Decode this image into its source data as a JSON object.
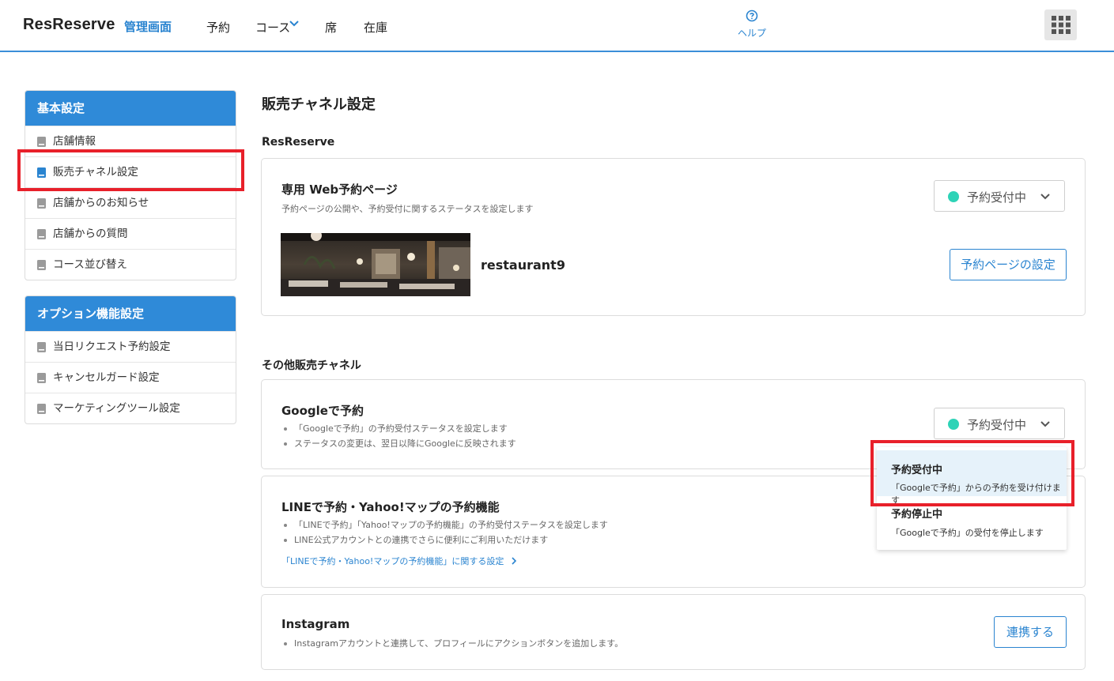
{
  "header": {
    "logo": "ResReserve",
    "logo_sub": "管理画面",
    "nav": [
      "予約",
      "コース",
      "席",
      "在庫"
    ],
    "help_label": "ヘルプ"
  },
  "sidebar": {
    "basic": {
      "title": "基本設定",
      "items": [
        "店舗情報",
        "販売チャネル設定",
        "店舗からのお知らせ",
        "店舗からの質問",
        "コース並び替え"
      ]
    },
    "options": {
      "title": "オプション機能設定",
      "items": [
        "当日リクエスト予約設定",
        "キャンセルガード設定",
        "マーケティングツール設定"
      ]
    }
  },
  "main": {
    "title": "販売チャネル設定",
    "resreserve_section": "ResReserve",
    "web": {
      "title": "専用 Web予約ページ",
      "desc": "予約ページの公開や、予約受付に関するステータスを設定します",
      "status": "予約受付中",
      "shop_name": "restaurant9",
      "settings_button": "予約ページの設定"
    },
    "other_section": "その他販売チャネル",
    "google": {
      "title": "Googleで予約",
      "bullets": [
        "「Googleで予約」の予約受付ステータスを設定します",
        "ステータスの変更は、翌日以降にGoogleに反映されます"
      ],
      "status": "予約受付中"
    },
    "line": {
      "title": "LINEで予約・Yahoo!マップの予約機能",
      "bullets": [
        "「LINEで予約」「Yahoo!マップの予約機能」の予約受付ステータスを設定します",
        "LINE公式アカウントとの連携でさらに便利にご利用いただけます"
      ],
      "link": "「LINEで予約・Yahoo!マップの予約機能」に関する設定"
    },
    "instagram": {
      "title": "Instagram",
      "bullets": [
        "Instagramアカウントと連携して、プロフィールにアクションボタンを追加します。"
      ],
      "connect_button": "連携する"
    }
  },
  "dropdown": {
    "options": [
      {
        "title": "予約受付中",
        "desc": "「Googleで予約」からの予約を受け付けます"
      },
      {
        "title": "予約停止中",
        "desc": "「Googleで予約」の受付を停止します"
      }
    ]
  },
  "colors": {
    "accent": "#2a84d0",
    "status_green": "#2ed3b7",
    "highlight": "#e8202a"
  }
}
